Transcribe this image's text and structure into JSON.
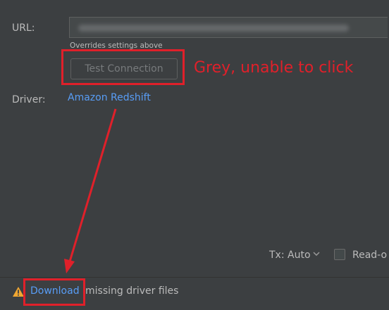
{
  "form": {
    "url_label": "URL:",
    "url_hint": "Overrides settings above",
    "test_connection_label": "Test Connection",
    "driver_label": "Driver:",
    "driver_value": "Amazon Redshift"
  },
  "options": {
    "tx_label": "Tx: Auto",
    "readonly_label": "Read-o"
  },
  "status": {
    "download_label": "Download",
    "missing_text": "missing driver files"
  },
  "annotation": {
    "text": "Grey, unable to click",
    "color": "#e0202a"
  },
  "colors": {
    "background": "#3c3f41",
    "link": "#589df6",
    "disabled_text": "#777a7c",
    "warning": "#f0a732"
  }
}
